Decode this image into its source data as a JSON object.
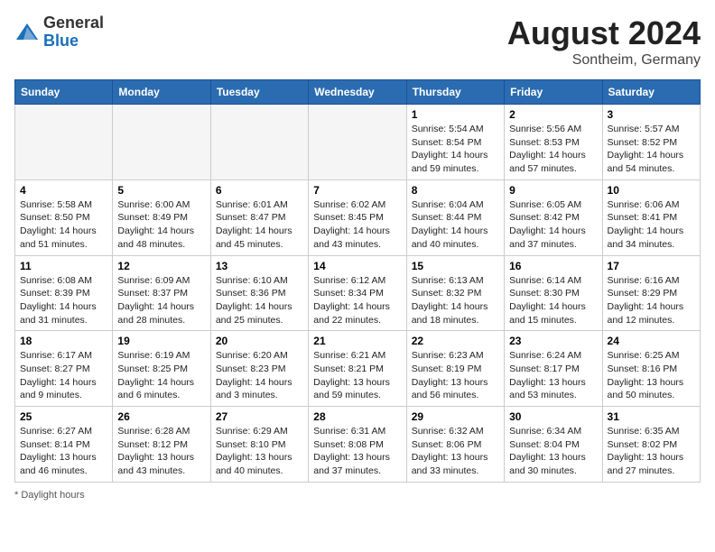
{
  "header": {
    "logo_general": "General",
    "logo_blue": "Blue",
    "month_year": "August 2024",
    "location": "Sontheim, Germany"
  },
  "footer": {
    "note": "Daylight hours"
  },
  "days_of_week": [
    "Sunday",
    "Monday",
    "Tuesday",
    "Wednesday",
    "Thursday",
    "Friday",
    "Saturday"
  ],
  "weeks": [
    [
      {
        "day": "",
        "info": ""
      },
      {
        "day": "",
        "info": ""
      },
      {
        "day": "",
        "info": ""
      },
      {
        "day": "",
        "info": ""
      },
      {
        "day": "1",
        "info": "Sunrise: 5:54 AM\nSunset: 8:54 PM\nDaylight: 14 hours and 59 minutes."
      },
      {
        "day": "2",
        "info": "Sunrise: 5:56 AM\nSunset: 8:53 PM\nDaylight: 14 hours and 57 minutes."
      },
      {
        "day": "3",
        "info": "Sunrise: 5:57 AM\nSunset: 8:52 PM\nDaylight: 14 hours and 54 minutes."
      }
    ],
    [
      {
        "day": "4",
        "info": "Sunrise: 5:58 AM\nSunset: 8:50 PM\nDaylight: 14 hours and 51 minutes."
      },
      {
        "day": "5",
        "info": "Sunrise: 6:00 AM\nSunset: 8:49 PM\nDaylight: 14 hours and 48 minutes."
      },
      {
        "day": "6",
        "info": "Sunrise: 6:01 AM\nSunset: 8:47 PM\nDaylight: 14 hours and 45 minutes."
      },
      {
        "day": "7",
        "info": "Sunrise: 6:02 AM\nSunset: 8:45 PM\nDaylight: 14 hours and 43 minutes."
      },
      {
        "day": "8",
        "info": "Sunrise: 6:04 AM\nSunset: 8:44 PM\nDaylight: 14 hours and 40 minutes."
      },
      {
        "day": "9",
        "info": "Sunrise: 6:05 AM\nSunset: 8:42 PM\nDaylight: 14 hours and 37 minutes."
      },
      {
        "day": "10",
        "info": "Sunrise: 6:06 AM\nSunset: 8:41 PM\nDaylight: 14 hours and 34 minutes."
      }
    ],
    [
      {
        "day": "11",
        "info": "Sunrise: 6:08 AM\nSunset: 8:39 PM\nDaylight: 14 hours and 31 minutes."
      },
      {
        "day": "12",
        "info": "Sunrise: 6:09 AM\nSunset: 8:37 PM\nDaylight: 14 hours and 28 minutes."
      },
      {
        "day": "13",
        "info": "Sunrise: 6:10 AM\nSunset: 8:36 PM\nDaylight: 14 hours and 25 minutes."
      },
      {
        "day": "14",
        "info": "Sunrise: 6:12 AM\nSunset: 8:34 PM\nDaylight: 14 hours and 22 minutes."
      },
      {
        "day": "15",
        "info": "Sunrise: 6:13 AM\nSunset: 8:32 PM\nDaylight: 14 hours and 18 minutes."
      },
      {
        "day": "16",
        "info": "Sunrise: 6:14 AM\nSunset: 8:30 PM\nDaylight: 14 hours and 15 minutes."
      },
      {
        "day": "17",
        "info": "Sunrise: 6:16 AM\nSunset: 8:29 PM\nDaylight: 14 hours and 12 minutes."
      }
    ],
    [
      {
        "day": "18",
        "info": "Sunrise: 6:17 AM\nSunset: 8:27 PM\nDaylight: 14 hours and 9 minutes."
      },
      {
        "day": "19",
        "info": "Sunrise: 6:19 AM\nSunset: 8:25 PM\nDaylight: 14 hours and 6 minutes."
      },
      {
        "day": "20",
        "info": "Sunrise: 6:20 AM\nSunset: 8:23 PM\nDaylight: 14 hours and 3 minutes."
      },
      {
        "day": "21",
        "info": "Sunrise: 6:21 AM\nSunset: 8:21 PM\nDaylight: 13 hours and 59 minutes."
      },
      {
        "day": "22",
        "info": "Sunrise: 6:23 AM\nSunset: 8:19 PM\nDaylight: 13 hours and 56 minutes."
      },
      {
        "day": "23",
        "info": "Sunrise: 6:24 AM\nSunset: 8:17 PM\nDaylight: 13 hours and 53 minutes."
      },
      {
        "day": "24",
        "info": "Sunrise: 6:25 AM\nSunset: 8:16 PM\nDaylight: 13 hours and 50 minutes."
      }
    ],
    [
      {
        "day": "25",
        "info": "Sunrise: 6:27 AM\nSunset: 8:14 PM\nDaylight: 13 hours and 46 minutes."
      },
      {
        "day": "26",
        "info": "Sunrise: 6:28 AM\nSunset: 8:12 PM\nDaylight: 13 hours and 43 minutes."
      },
      {
        "day": "27",
        "info": "Sunrise: 6:29 AM\nSunset: 8:10 PM\nDaylight: 13 hours and 40 minutes."
      },
      {
        "day": "28",
        "info": "Sunrise: 6:31 AM\nSunset: 8:08 PM\nDaylight: 13 hours and 37 minutes."
      },
      {
        "day": "29",
        "info": "Sunrise: 6:32 AM\nSunset: 8:06 PM\nDaylight: 13 hours and 33 minutes."
      },
      {
        "day": "30",
        "info": "Sunrise: 6:34 AM\nSunset: 8:04 PM\nDaylight: 13 hours and 30 minutes."
      },
      {
        "day": "31",
        "info": "Sunrise: 6:35 AM\nSunset: 8:02 PM\nDaylight: 13 hours and 27 minutes."
      }
    ]
  ]
}
